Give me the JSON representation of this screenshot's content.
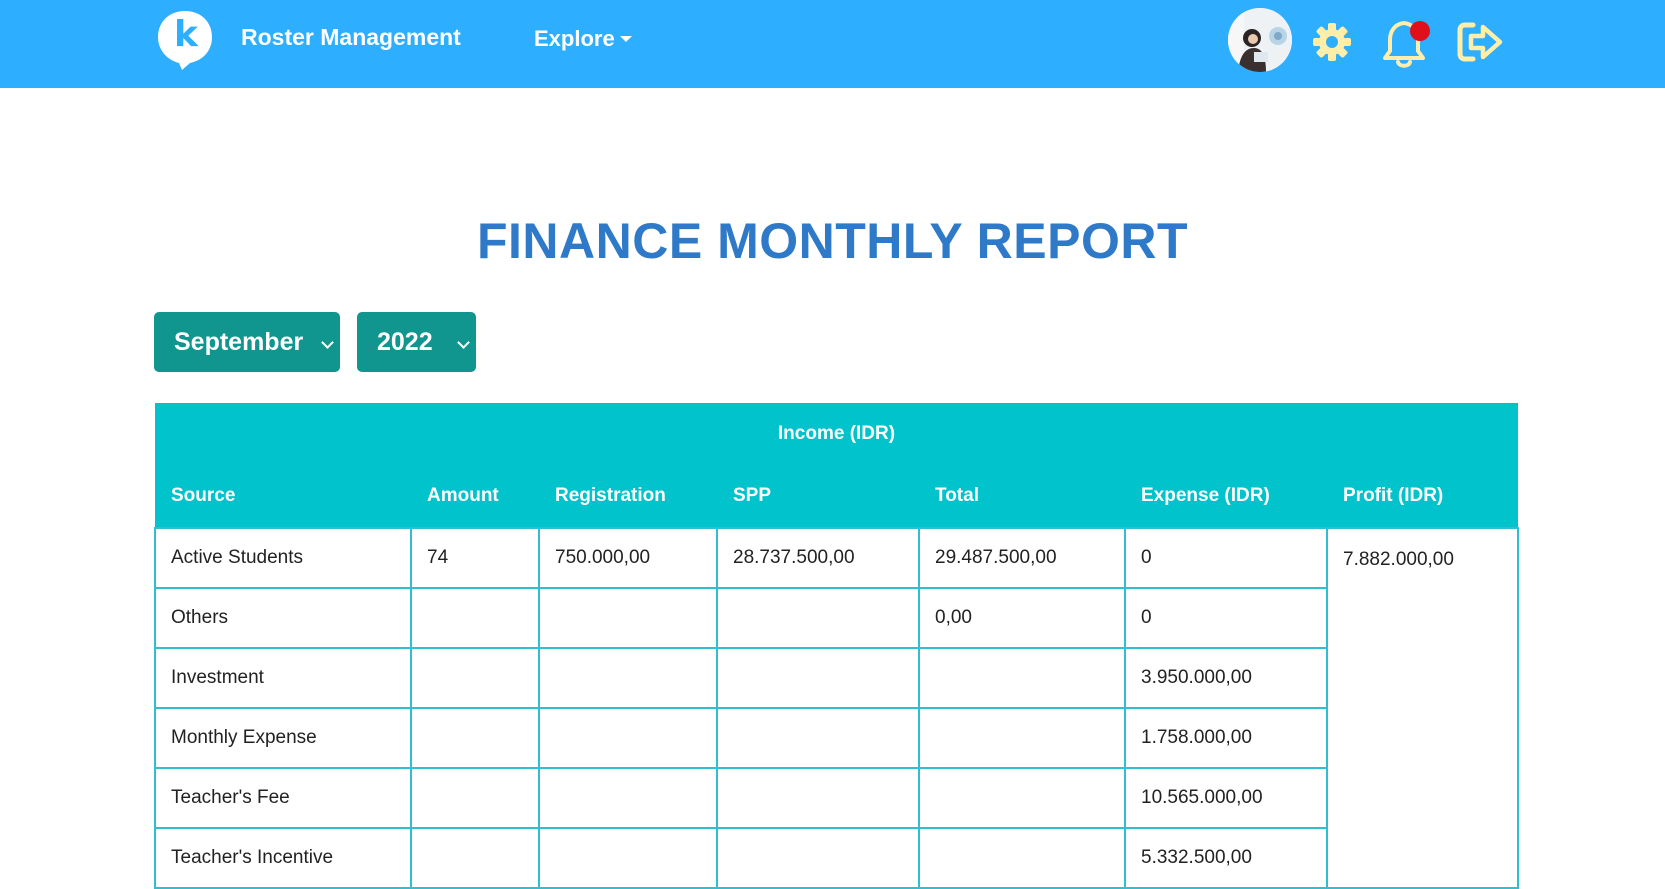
{
  "navbar": {
    "brand_letter": "k",
    "brand_text": "Roster Management",
    "explore_label": "Explore",
    "icons": [
      "avatar",
      "gear-icon",
      "bell-icon",
      "logout-icon"
    ],
    "notification_dot_color": "#e0101a",
    "icon_color": "#ffeeaa",
    "background_color": "#2eaeff"
  },
  "page": {
    "title": "FINANCE MONTHLY REPORT"
  },
  "filters": {
    "month": "September",
    "year": "2022"
  },
  "table": {
    "group_header": "Income (IDR)",
    "columns": [
      "Source",
      "Amount",
      "Registration",
      "SPP",
      "Total",
      "Expense (IDR)",
      "Profit (IDR)"
    ],
    "rows": [
      {
        "source": "Active Students",
        "amount": "74",
        "registration": "750.000,00",
        "spp": "28.737.500,00",
        "total": "29.487.500,00",
        "expense": "0"
      },
      {
        "source": "Others",
        "amount": "",
        "registration": "",
        "spp": "",
        "total": "0,00",
        "expense": "0"
      },
      {
        "source": "Investment",
        "amount": "",
        "registration": "",
        "spp": "",
        "total": "",
        "expense": "3.950.000,00"
      },
      {
        "source": "Monthly Expense",
        "amount": "",
        "registration": "",
        "spp": "",
        "total": "",
        "expense": "1.758.000,00"
      },
      {
        "source": "Teacher's Fee",
        "amount": "",
        "registration": "",
        "spp": "",
        "total": "",
        "expense": "10.565.000,00"
      },
      {
        "source": "Teacher's Incentive",
        "amount": "",
        "registration": "",
        "spp": "",
        "total": "",
        "expense": "5.332.500,00"
      }
    ],
    "profit": "7.882.000,00"
  }
}
